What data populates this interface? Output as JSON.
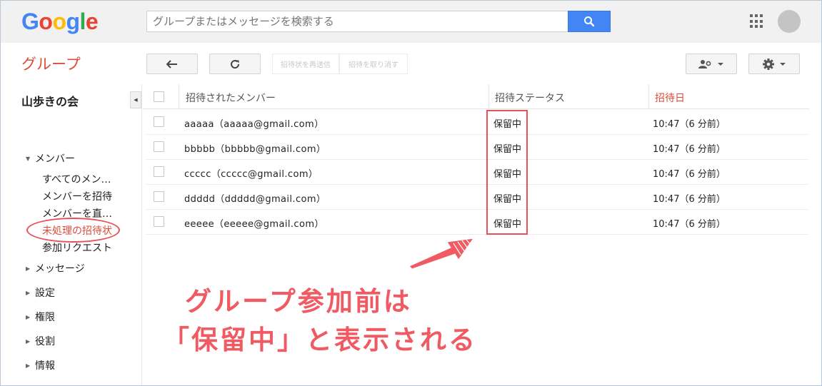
{
  "header": {
    "logo_letters": [
      "G",
      "o",
      "o",
      "g",
      "l",
      "e"
    ],
    "search_placeholder": "グループまたはメッセージを検索する"
  },
  "toolbar": {
    "title": "グループ",
    "resend_label": "招待状を再送信",
    "revoke_label": "招待を取り消す"
  },
  "sidebar": {
    "group_name": "山歩きの会",
    "members_label": "メンバー",
    "sub_items": [
      "すべてのメン…",
      "メンバーを招待",
      "メンバーを直…",
      "未処理の招待状",
      "参加リクエスト"
    ],
    "sections": [
      "メッセージ",
      "設定",
      "権限",
      "役割",
      "情報"
    ]
  },
  "table": {
    "columns": [
      "招待されたメンバー",
      "招待ステータス",
      "招待日"
    ],
    "rows": [
      {
        "member": "aaaaa（aaaaa@gmail.com）",
        "status": "保留中",
        "date": "10:47（6 分前）"
      },
      {
        "member": "bbbbb（bbbbb@gmail.com）",
        "status": "保留中",
        "date": "10:47（6 分前）"
      },
      {
        "member": "ccccc（ccccc@gmail.com）",
        "status": "保留中",
        "date": "10:47（6 分前）"
      },
      {
        "member": "ddddd（ddddd@gmail.com）",
        "status": "保留中",
        "date": "10:47（6 分前）"
      },
      {
        "member": "eeeee（eeeee@gmail.com）",
        "status": "保留中",
        "date": "10:47（6 分前）"
      }
    ]
  },
  "annotation": {
    "line1": "グループ参加前は",
    "line2": "「保留中」と表示される"
  },
  "colors": {
    "accent_red": "#dd4b39",
    "annotation_red": "#f05a62",
    "search_blue": "#4285f4",
    "logo_blue": "#4285f4",
    "logo_red": "#ea4335",
    "logo_yellow": "#fbbc05",
    "logo_green": "#34a853"
  },
  "icons": [
    "search-icon",
    "apps-grid-icon",
    "back-arrow-icon",
    "refresh-icon",
    "add-member-icon",
    "gear-icon",
    "collapse-icon",
    "chevron-down-icon"
  ]
}
